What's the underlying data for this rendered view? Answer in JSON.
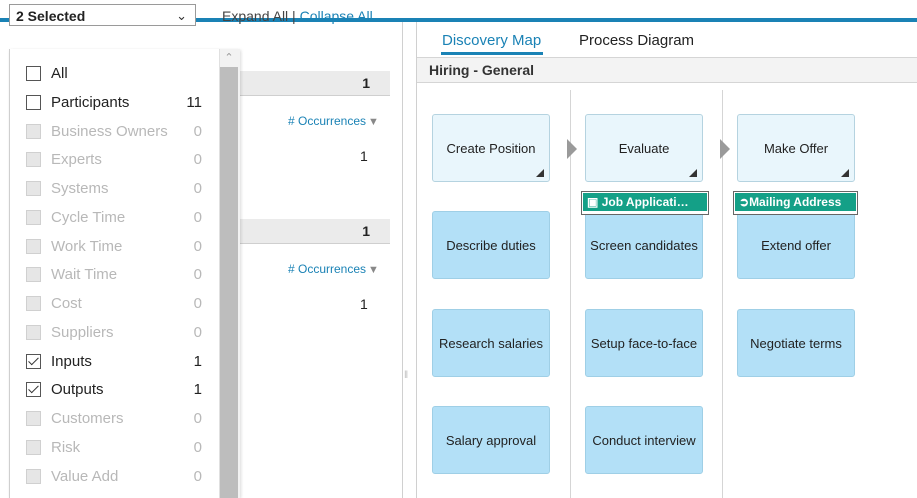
{
  "filter": {
    "selected_label": "2 Selected",
    "expand_all": "Expand All",
    "separator": " | ",
    "collapse_all": "Collapse All",
    "options": [
      {
        "label": "All",
        "count": "",
        "checked": false,
        "disabled": false
      },
      {
        "label": "Participants",
        "count": "11",
        "checked": false,
        "disabled": false
      },
      {
        "label": "Business Owners",
        "count": "0",
        "checked": false,
        "disabled": true
      },
      {
        "label": "Experts",
        "count": "0",
        "checked": false,
        "disabled": true
      },
      {
        "label": "Systems",
        "count": "0",
        "checked": false,
        "disabled": true
      },
      {
        "label": "Cycle Time",
        "count": "0",
        "checked": false,
        "disabled": true
      },
      {
        "label": "Work Time",
        "count": "0",
        "checked": false,
        "disabled": true
      },
      {
        "label": "Wait Time",
        "count": "0",
        "checked": false,
        "disabled": true
      },
      {
        "label": "Cost",
        "count": "0",
        "checked": false,
        "disabled": true
      },
      {
        "label": "Suppliers",
        "count": "0",
        "checked": false,
        "disabled": true
      },
      {
        "label": "Inputs",
        "count": "1",
        "checked": true,
        "disabled": false
      },
      {
        "label": "Outputs",
        "count": "1",
        "checked": true,
        "disabled": false
      },
      {
        "label": "Customers",
        "count": "0",
        "checked": false,
        "disabled": true
      },
      {
        "label": "Risk",
        "count": "0",
        "checked": false,
        "disabled": true
      },
      {
        "label": "Value Add",
        "count": "0",
        "checked": false,
        "disabled": true
      }
    ]
  },
  "groups": [
    {
      "header_count": "1",
      "occurrences_label": "# Occurrences",
      "occurrences_value": "1"
    },
    {
      "header_count": "1",
      "occurrences_label": "# Occurrences",
      "occurrences_value": "1"
    }
  ],
  "tabs": {
    "discovery_map": "Discovery Map",
    "process_diagram": "Process Diagram"
  },
  "map": {
    "title": "Hiring - General",
    "columns": [
      {
        "head": "Create Position",
        "tag": "",
        "steps": [
          "Describe duties",
          "Research salaries",
          "Salary approval"
        ]
      },
      {
        "head": "Evaluate",
        "tag": "Job Applicati…",
        "steps": [
          "Screen candidates",
          "Setup face-to-face",
          "Conduct interview"
        ]
      },
      {
        "head": "Make Offer",
        "tag": "Mailing Address",
        "steps": [
          "Extend offer",
          "Negotiate terms"
        ]
      }
    ]
  },
  "colors": {
    "accent": "#1a82b5",
    "step_fill": "#b3e0f7",
    "head_fill": "#e9f6fc",
    "tag_fill": "#14a087"
  }
}
